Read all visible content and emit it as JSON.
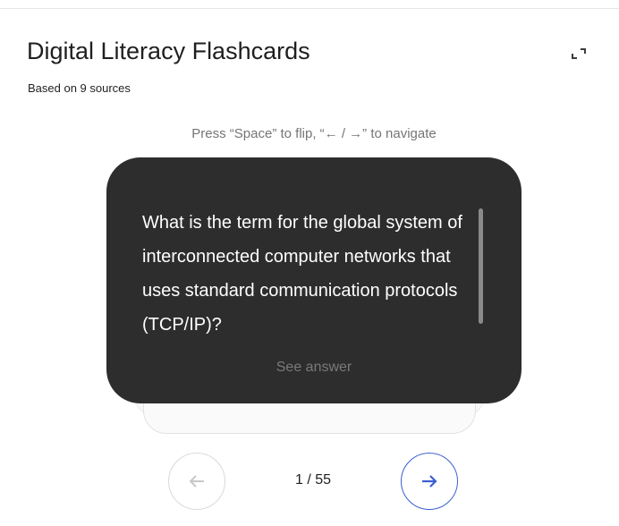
{
  "header": {
    "title": "Digital Literacy Flashcards",
    "subtitle": "Based on 9 sources",
    "expand_icon": "expand-icon"
  },
  "hint": "Press “Space” to flip, “← / →” to navigate",
  "card": {
    "question": "What is the term for the global system of interconnected computer networks that uses standard communication protocols (TCP/IP)?",
    "see_answer_label": "See answer"
  },
  "navigation": {
    "prev_icon": "arrow-left-icon",
    "next_icon": "arrow-right-icon",
    "counter": "1 / 55"
  },
  "colors": {
    "card_background": "#2d2d2d",
    "accent": "#3b5fd0"
  }
}
